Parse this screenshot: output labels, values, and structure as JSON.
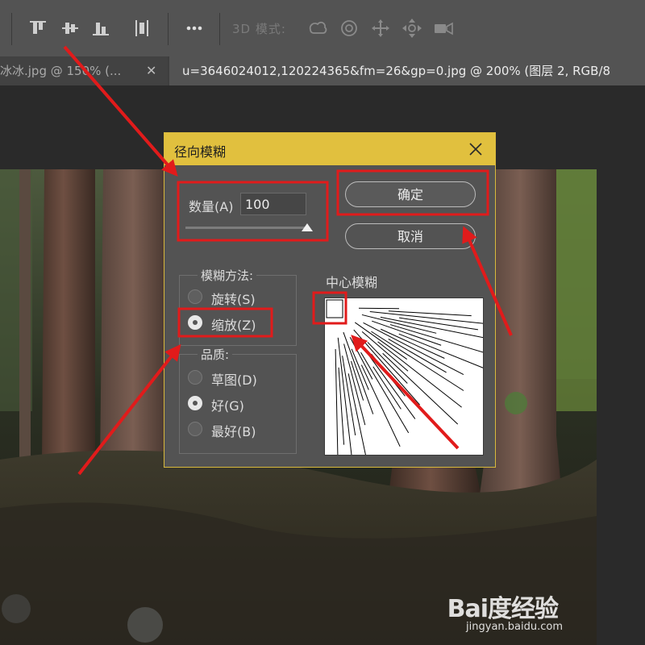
{
  "toolbar": {
    "mode_label": "3D 模式:",
    "icons": [
      "align-top-icon",
      "align-vertical-center-icon",
      "align-bottom-icon",
      "distribute-horizontal-icon",
      "more-icon",
      "orbit-3d-icon",
      "roll-3d-icon",
      "pan-3d-icon",
      "slide-3d-icon",
      "scale-3d-icon"
    ]
  },
  "tabs": [
    {
      "label": "冰冰.jpg @ 150% (..."
    },
    {
      "label": "u=3646024012,120224365&fm=26&gp=0.jpg @ 200% (图层 2, RGB/8"
    }
  ],
  "dialog": {
    "title": "径向模糊",
    "amount_label": "数量(A)",
    "amount_value": "100",
    "amount_fraction": 1.0,
    "ok_label": "确定",
    "cancel_label": "取消",
    "blur_method": {
      "title": "模糊方法:",
      "options": [
        {
          "label": "旋转(S)",
          "selected": false
        },
        {
          "label": "缩放(Z)",
          "selected": true
        }
      ]
    },
    "quality": {
      "title": "品质:",
      "options": [
        {
          "label": "草图(D)",
          "selected": false
        },
        {
          "label": "好(G)",
          "selected": true
        },
        {
          "label": "最好(B)",
          "selected": false
        }
      ]
    },
    "center_label": "中心模糊"
  },
  "watermark": {
    "logo": "Bai度经验",
    "url": "jingyan.baidu.com"
  },
  "colors": {
    "title_bar": "#e1c03e",
    "annotation": "#e11b1b",
    "panel": "#535353"
  }
}
